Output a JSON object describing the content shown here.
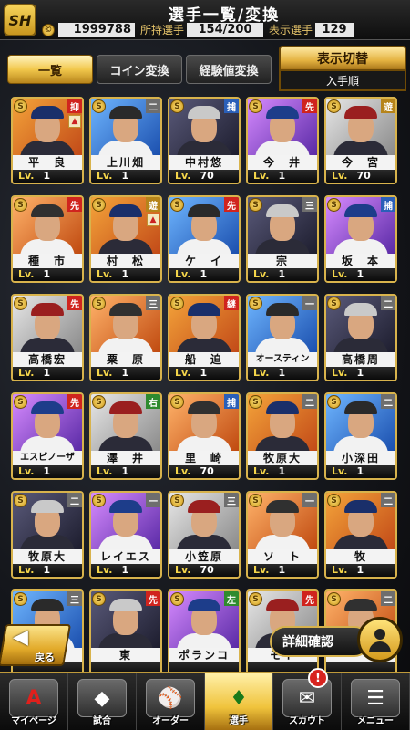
{
  "header": {
    "title": "選手一覧/変換",
    "logo_text": "SH",
    "coins": "1999788",
    "owned_label": "所持選手",
    "owned_value": "154/200",
    "shown_label": "表示選手",
    "shown_value": "129"
  },
  "tabs": [
    {
      "label": "一覧",
      "active": true
    },
    {
      "label": "コイン変換",
      "active": false
    },
    {
      "label": "経験値変換",
      "active": false
    }
  ],
  "display_switch": {
    "label": "表示切替",
    "sort": "入手順"
  },
  "cards": [
    {
      "name": "平　良",
      "pos": "抑",
      "lv": "1",
      "up": true
    },
    {
      "name": "上川畑",
      "pos": "二",
      "lv": "1",
      "up": false
    },
    {
      "name": "中村悠",
      "pos": "捕",
      "lv": "70",
      "up": false
    },
    {
      "name": "今　井",
      "pos": "先",
      "lv": "1",
      "up": false
    },
    {
      "name": "今　宮",
      "pos": "遊",
      "lv": "70",
      "up": false
    },
    {
      "name": "種　市",
      "pos": "先",
      "lv": "1",
      "up": false
    },
    {
      "name": "村　松",
      "pos": "遊",
      "lv": "1",
      "up": true
    },
    {
      "name": "ケ　イ",
      "pos": "先",
      "lv": "1",
      "up": false
    },
    {
      "name": "宗",
      "pos": "三",
      "lv": "1",
      "up": false
    },
    {
      "name": "坂　本",
      "pos": "捕",
      "lv": "1",
      "up": false
    },
    {
      "name": "高橋宏",
      "pos": "先",
      "lv": "1",
      "up": false
    },
    {
      "name": "粟　原",
      "pos": "三",
      "lv": "1",
      "up": false
    },
    {
      "name": "船　迫",
      "pos": "継",
      "lv": "1",
      "up": false
    },
    {
      "name": "オースティン",
      "pos": "一",
      "lv": "1",
      "up": false
    },
    {
      "name": "高橋周",
      "pos": "二",
      "lv": "1",
      "up": false
    },
    {
      "name": "エスピノーザ",
      "pos": "先",
      "lv": "1",
      "up": false
    },
    {
      "name": "澤　井",
      "pos": "右",
      "lv": "1",
      "up": false
    },
    {
      "name": "里　崎",
      "pos": "捕",
      "lv": "70",
      "up": false
    },
    {
      "name": "牧原大",
      "pos": "二",
      "lv": "1",
      "up": false
    },
    {
      "name": "小深田",
      "pos": "二",
      "lv": "1",
      "up": false
    },
    {
      "name": "牧原大",
      "pos": "二",
      "lv": "1",
      "up": false
    },
    {
      "name": "レイエス",
      "pos": "一",
      "lv": "1",
      "up": false
    },
    {
      "name": "小笠原",
      "pos": "三",
      "lv": "70",
      "up": false
    },
    {
      "name": "ソ　ト",
      "pos": "一",
      "lv": "1",
      "up": false
    },
    {
      "name": "牧",
      "pos": "二",
      "lv": "1",
      "up": false
    },
    {
      "name": "",
      "pos": "三",
      "lv": "",
      "up": false
    },
    {
      "name": "東",
      "pos": "先",
      "lv": "",
      "up": false
    },
    {
      "name": "ポランコ",
      "pos": "左",
      "lv": "",
      "up": false
    },
    {
      "name": "モイ",
      "pos": "先",
      "lv": "",
      "up": false
    },
    {
      "name": "",
      "pos": "二",
      "lv": "",
      "up": false
    }
  ],
  "level_prefix": "Lv.",
  "coin_letter": "S",
  "back_label": "戻る",
  "detail_label": "詳細確認",
  "nav": [
    {
      "label": "マイページ",
      "icon": "A",
      "active": false,
      "badge": ""
    },
    {
      "label": "試合",
      "icon": "◆",
      "active": false,
      "badge": ""
    },
    {
      "label": "オーダー",
      "icon": "⚾",
      "active": false,
      "badge": ""
    },
    {
      "label": "選手",
      "icon": "♦",
      "active": true,
      "badge": ""
    },
    {
      "label": "スカウト",
      "icon": "✉",
      "active": false,
      "badge": "!"
    },
    {
      "label": "メニュー",
      "icon": "☰",
      "active": false,
      "badge": ""
    }
  ],
  "colors": {
    "accent": "#e4b240",
    "pos_red": "#d0241e",
    "pos_gray": "#6e6e6e",
    "pos_blue": "#2a5fb8",
    "pos_green": "#2f8b2f",
    "pos_gold": "#b6841a"
  }
}
